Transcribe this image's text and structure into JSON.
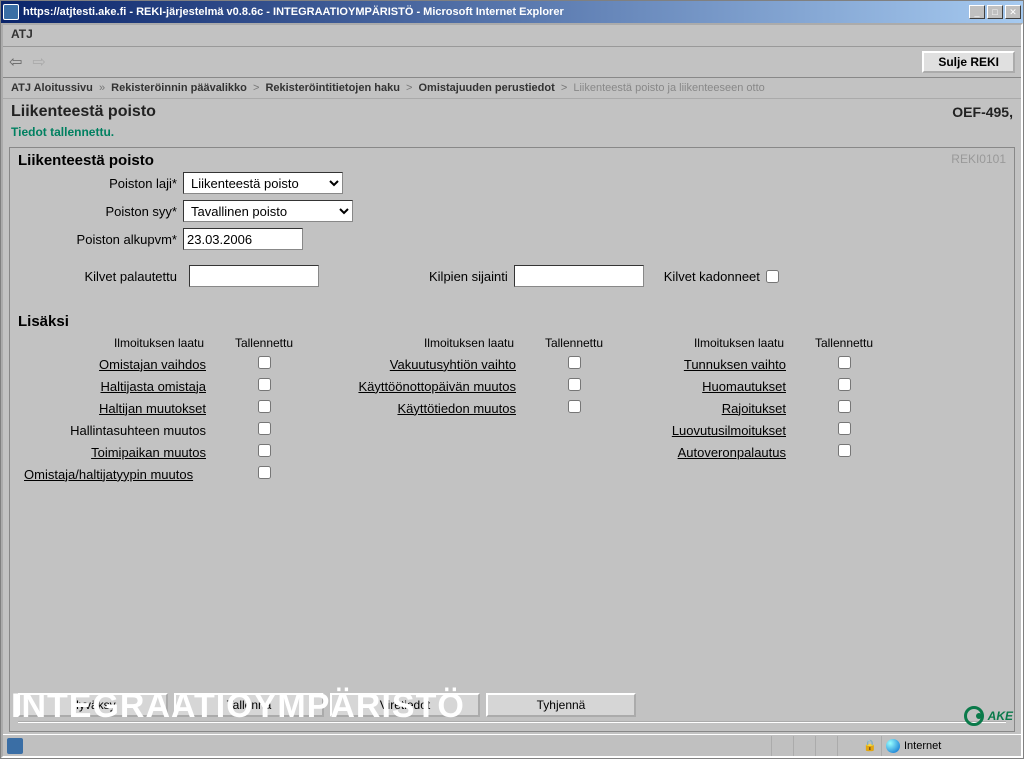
{
  "window": {
    "title": "https://atjtesti.ake.fi - REKI-järjestelmä v0.8.6c - INTEGRAATIOYMPÄRISTÖ - Microsoft Internet Explorer"
  },
  "menubar": {
    "app": "ATJ"
  },
  "close_button": "Sulje REKI",
  "breadcrumb": [
    "ATJ Aloitussivu",
    "Rekisteröinnin päävalikko",
    "Rekisteröintitietojen haku",
    "Omistajuuden perustiedot",
    "Liikenteestä poisto ja liikenteeseen otto"
  ],
  "page": {
    "title": "Liikenteestä poisto",
    "record": "OEF-495,",
    "status": "Tiedot tallennettu."
  },
  "panel": {
    "title": "Liikenteestä poisto",
    "code": "REKI0101"
  },
  "form": {
    "poiston_laji_label": "Poiston laji*",
    "poiston_laji_value": "Liikenteestä poisto",
    "poiston_syy_label": "Poiston syy*",
    "poiston_syy_value": "Tavallinen poisto",
    "poiston_alkupvm_label": "Poiston alkupvm*",
    "poiston_alkupvm_value": "23.03.2006",
    "kilvet_palautettu_label": "Kilvet palautettu",
    "kilvet_palautettu_value": "",
    "kilpien_sijainti_label": "Kilpien sijainti",
    "kilpien_sijainti_value": "",
    "kilvet_kadonneet_label": "Kilvet kadonneet"
  },
  "lisaksi": {
    "title": "Lisäksi",
    "header_laatu": "Ilmoituksen laatu",
    "header_tallennettu": "Tallennettu",
    "col1": [
      {
        "label": "Omistajan vaihdos",
        "link": true
      },
      {
        "label": "Haltijasta omistaja",
        "link": true
      },
      {
        "label": "Haltijan muutokset",
        "link": true
      },
      {
        "label": "Hallintasuhteen muutos",
        "link": false
      },
      {
        "label": "Toimipaikan muutos",
        "link": true
      },
      {
        "label": "Omistaja/haltijatyypin muutos",
        "link": true
      }
    ],
    "col2": [
      {
        "label": "Vakuutusyhtiön vaihto",
        "link": true
      },
      {
        "label": "Käyttöönottopäivän muutos",
        "link": true
      },
      {
        "label": "Käyttötiedon muutos",
        "link": true
      }
    ],
    "col3": [
      {
        "label": "Tunnuksen vaihto",
        "link": true
      },
      {
        "label": "Huomautukset",
        "link": true
      },
      {
        "label": "Rajoitukset",
        "link": true
      },
      {
        "label": "Luovutusilmoitukset",
        "link": true
      },
      {
        "label": "Autoveronpalautus",
        "link": true
      }
    ]
  },
  "buttons": {
    "hyvaksy": "Hyväksy",
    "tallenna": "Tallenna",
    "viretiedot": "Viretiedot",
    "tyhjenna": "Tyhjennä"
  },
  "watermark": "INTEGRAATIOYMPÄRISTÖ",
  "logo_text": "AKE",
  "statusbar": {
    "zone": "Internet"
  }
}
